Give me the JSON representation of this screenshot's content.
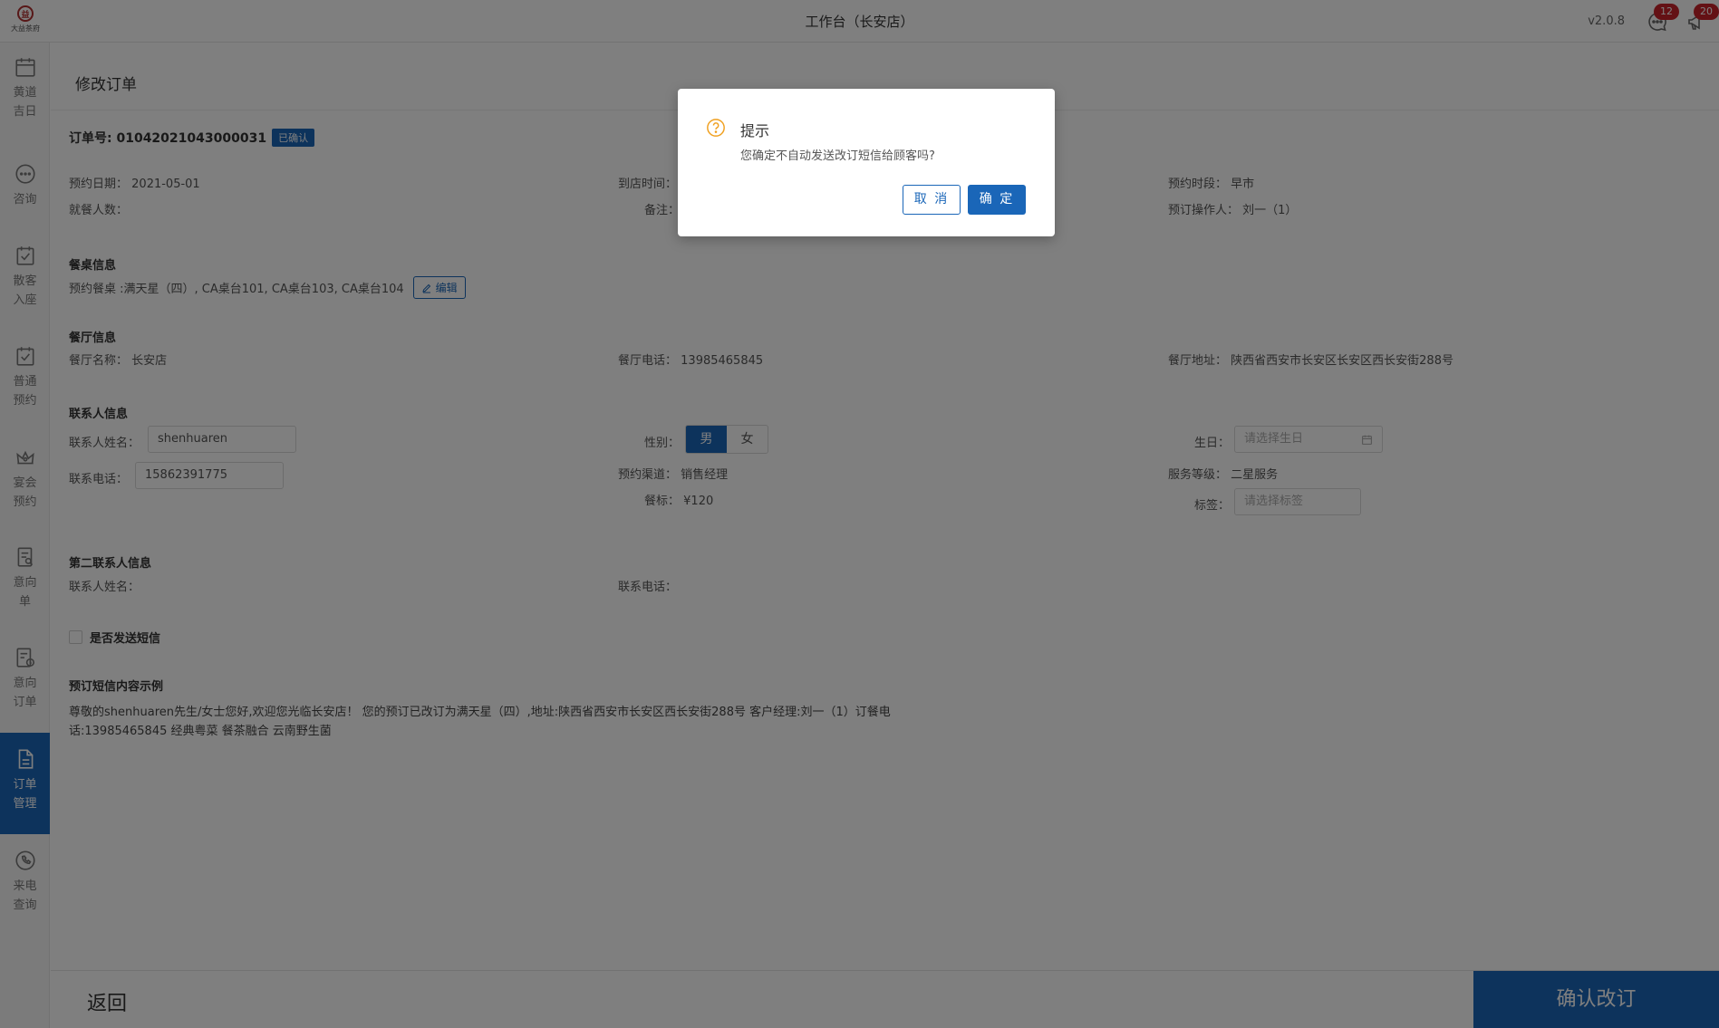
{
  "app": {
    "logo_text": "大益茶府",
    "title": "工作台（长安店）",
    "version": "v2.0.8",
    "messages_badge": "12",
    "notifications_badge": "20"
  },
  "sidebar": {
    "items": [
      {
        "label": "黄道吉日",
        "icon": "calendar-icon",
        "active": false
      },
      {
        "label": "咨询",
        "icon": "chat-icon",
        "active": false
      },
      {
        "label": "散客入座",
        "icon": "calendar-check-icon",
        "active": false
      },
      {
        "label": "普通预约",
        "icon": "calendar-check-icon",
        "active": false
      },
      {
        "label": "宴会预约",
        "icon": "crown-icon",
        "active": false
      },
      {
        "label": "意向单",
        "icon": "doc-search-icon",
        "active": false
      },
      {
        "label": "意向订单",
        "icon": "doc-clock-icon",
        "active": false
      },
      {
        "label": "订单管理",
        "icon": "document-icon",
        "active": true
      },
      {
        "label": "来电查询",
        "icon": "phone-icon",
        "active": false
      }
    ]
  },
  "page": {
    "title": "修改订单",
    "order_no": "订单号: 01042021043000031",
    "status": "已确认",
    "booking_date_label": "预约日期：",
    "booking_date": "2021-05-01",
    "arrival_time_label": "到店时间：",
    "period_label": "预约时段：",
    "period": "早市",
    "guests_label": "就餐人数：",
    "remark_label": "备注：",
    "operator_label": "预订操作人：",
    "operator": "刘一（1）",
    "table_section": "餐桌信息",
    "table_text": "预约餐桌 :满天星（四）, CA桌台101, CA桌台103, CA桌台104",
    "edit_label": "编辑",
    "restaurant_section": "餐厅信息",
    "restaurant_name_label": "餐厅名称：",
    "restaurant_name": "长安店",
    "restaurant_phone_label": "餐厅电话：",
    "restaurant_phone": "13985465845",
    "restaurant_addr_label": "餐厅地址：",
    "restaurant_addr": "陕西省西安市长安区长安区西长安街288号",
    "contact_section": "联系人信息",
    "contact_name_label": "联系人姓名：",
    "contact_name": "shenhuaren",
    "gender_label": "性别：",
    "gender_male": "男",
    "gender_female": "女",
    "birthday_label": "生日：",
    "birthday_placeholder": "请选择生日",
    "contact_phone_label": "联系电话：",
    "contact_phone": "15862391775",
    "channel_label": "预约渠道：",
    "channel": "销售经理",
    "service_level_label": "服务等级：",
    "service_level": "二星服务",
    "meal_std_label": "餐标：",
    "meal_std": "¥120",
    "tag_label": "标签：",
    "tag_placeholder": "请选择标签",
    "second_contact_section": "第二联系人信息",
    "second_name_label": "联系人姓名：",
    "second_phone_label": "联系电话：",
    "sms_checkbox_label": "是否发送短信",
    "sms_example_section": "预订短信内容示例",
    "sms_text": "尊敬的shenhuaren先生/女士您好,欢迎您光临长安店！ 您的预订已改订为满天星（四）,地址:陕西省西安市长安区西长安街288号 客户经理:刘一（1）订餐电话:13985465845 经典粤菜 餐茶融合 云南野生菌"
  },
  "footer": {
    "back": "返回",
    "confirm": "确认改订"
  },
  "dialog": {
    "title": "提示",
    "message": "您确定不自动发送改订短信给顾客吗?",
    "cancel": "取 消",
    "ok": "确 定"
  },
  "colors": {
    "primary": "#1a66b8",
    "badge": "#c8232a",
    "warning_icon": "#f0a020"
  }
}
